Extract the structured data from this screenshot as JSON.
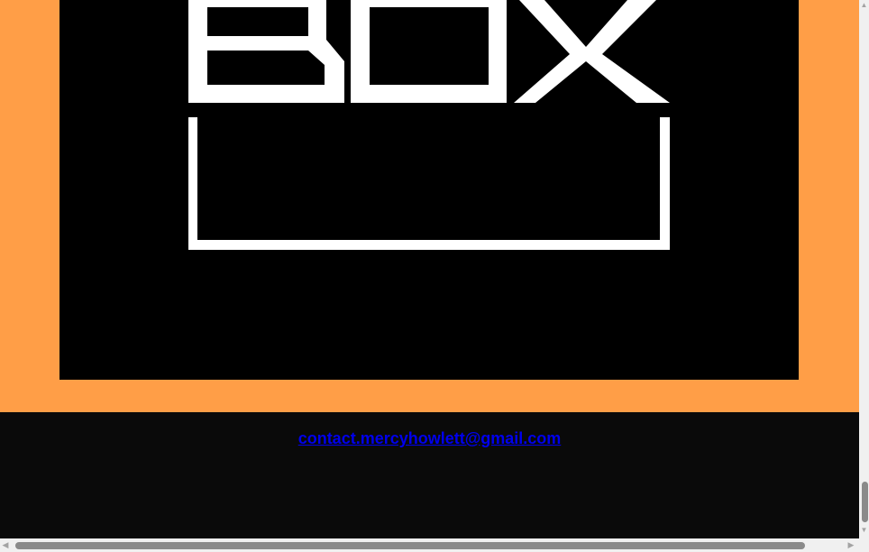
{
  "logo": {
    "text": "BOX",
    "foreground": "#ffffff",
    "background": "#000000"
  },
  "colors": {
    "orange_band": "#ff9e47",
    "footer_bg": "#0a0a0a",
    "link": "#0000ee"
  },
  "footer": {
    "contact_email": "contact.mercyhowlett@gmail.com"
  },
  "scrollbars": {
    "vertical_up_icon": "triangle-up",
    "vertical_down_icon": "triangle-down",
    "horizontal_left_icon": "triangle-left",
    "horizontal_right_icon": "triangle-right"
  }
}
